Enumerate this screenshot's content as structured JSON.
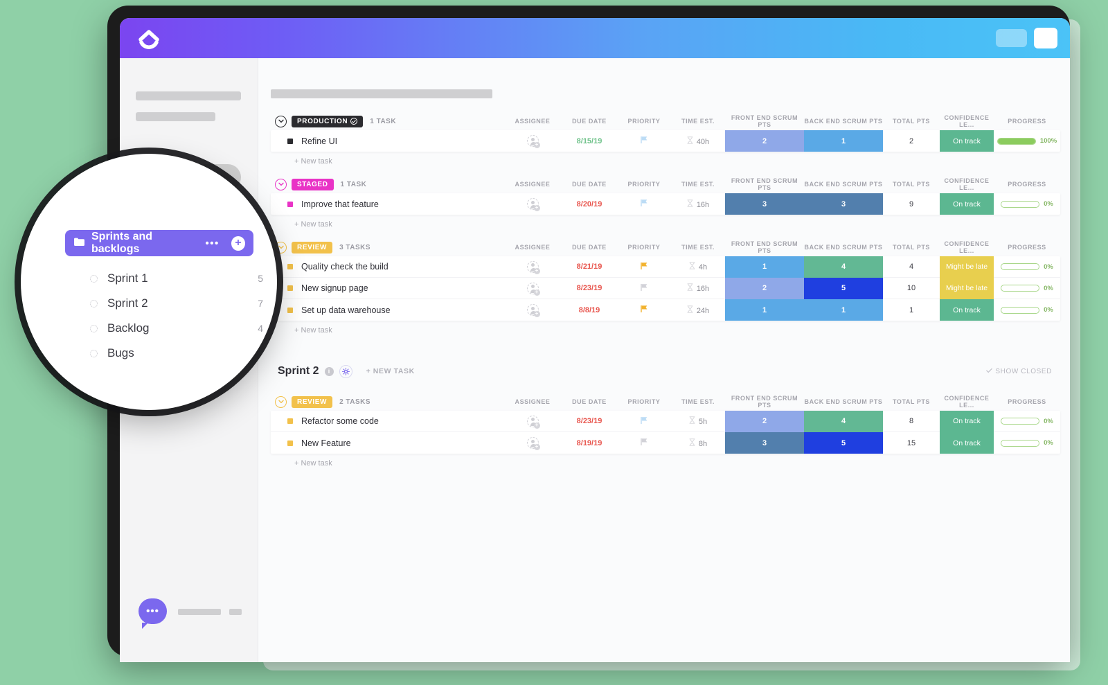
{
  "app": {
    "logo_icon": "clickup-logo-icon",
    "topbar_button_1": "",
    "topbar_button_2": ""
  },
  "sidebar": {
    "search_icon": "search-icon",
    "chat_icon": "chat-bubble-icon",
    "chat_label": "•••"
  },
  "magnifier": {
    "folder_icon": "folder-icon",
    "title": "Sprints and backlogs",
    "more_label": "•••",
    "add_label": "+",
    "items": [
      {
        "label": "Sprint 1",
        "count": "5"
      },
      {
        "label": "Sprint 2",
        "count": "7"
      },
      {
        "label": "Backlog",
        "count": "4"
      },
      {
        "label": "Bugs",
        "count": ""
      }
    ]
  },
  "columns": [
    "ASSIGNEE",
    "DUE DATE",
    "PRIORITY",
    "TIME EST.",
    "FRONT END SCRUM PTS",
    "BACK END SCRUM PTS",
    "TOTAL PTS",
    "CONFIDENCE LE...",
    "PROGRESS"
  ],
  "labels": {
    "new_task_inline": "+ New task",
    "new_task_button": "+ NEW TASK",
    "show_closed": "SHOW CLOSED",
    "check_icon": "check-icon"
  },
  "colors": {
    "production": "#2b2b2f",
    "staged": "#e933c6",
    "review": "#f2c14b",
    "fe_2": "#8fa8e8",
    "fe_1": "#5aa9e6",
    "fe_3": "#527fad",
    "be_1": "#5aa9e6",
    "be_3": "#527fad",
    "be_4": "#62b894",
    "be_5": "#1f3fe0",
    "on_track": "#5cb791",
    "might_be_late": "#e8cf4e",
    "date_ok": "#6fc28a",
    "date_late": "#e8554d",
    "progress": "#8ccc5e"
  },
  "sprint1": {
    "groups": [
      {
        "status": "PRODUCTION",
        "status_color": "#2b2b2f",
        "status_has_check": true,
        "count_label": "1 TASK",
        "tasks": [
          {
            "dot": "#2b2b2f",
            "name": "Refine UI",
            "due": "8/15/19",
            "due_state": "ok",
            "priority": "low",
            "time": "40h",
            "fe": "2",
            "fe_color": "#8fa8e8",
            "be": "1",
            "be_color": "#5aa9e6",
            "total": "2",
            "confidence": "On track",
            "confidence_color": "#5cb791",
            "progress": "100%",
            "progress_value": 100
          }
        ]
      },
      {
        "status": "STAGED",
        "status_color": "#e933c6",
        "status_has_check": false,
        "count_label": "1 TASK",
        "tasks": [
          {
            "dot": "#e933c6",
            "name": "Improve that feature",
            "due": "8/20/19",
            "due_state": "late",
            "priority": "low",
            "time": "16h",
            "fe": "3",
            "fe_color": "#527fad",
            "be": "3",
            "be_color": "#527fad",
            "total": "9",
            "confidence": "On track",
            "confidence_color": "#5cb791",
            "progress": "0%",
            "progress_value": 0
          }
        ]
      },
      {
        "status": "REVIEW",
        "status_color": "#f2c14b",
        "status_has_check": false,
        "count_label": "3 TASKS",
        "tasks": [
          {
            "dot": "#f2c14b",
            "name": "Quality check the build",
            "due": "8/21/19",
            "due_state": "late",
            "priority": "high",
            "time": "4h",
            "fe": "1",
            "fe_color": "#5aa9e6",
            "be": "4",
            "be_color": "#62b894",
            "total": "4",
            "confidence": "Might be late",
            "confidence_color": "#e8cf4e",
            "progress": "0%",
            "progress_value": 0
          },
          {
            "dot": "#f2c14b",
            "name": "New signup page",
            "due": "8/23/19",
            "due_state": "late",
            "priority": "none",
            "time": "16h",
            "fe": "2",
            "fe_color": "#8fa8e8",
            "be": "5",
            "be_color": "#1f3fe0",
            "total": "10",
            "confidence": "Might be late",
            "confidence_color": "#e8cf4e",
            "progress": "0%",
            "progress_value": 0
          },
          {
            "dot": "#f2c14b",
            "name": "Set up data warehouse",
            "due": "8/8/19",
            "due_state": "late",
            "priority": "high",
            "time": "24h",
            "fe": "1",
            "fe_color": "#5aa9e6",
            "be": "1",
            "be_color": "#5aa9e6",
            "total": "1",
            "confidence": "On track",
            "confidence_color": "#5cb791",
            "progress": "0%",
            "progress_value": 0
          }
        ]
      }
    ]
  },
  "sprint2": {
    "title": "Sprint 2",
    "info_icon": "info-icon",
    "settings_icon": "settings-icon",
    "groups": [
      {
        "status": "REVIEW",
        "status_color": "#f2c14b",
        "status_has_check": false,
        "count_label": "2 TASKS",
        "tasks": [
          {
            "dot": "#f2c14b",
            "name": "Refactor some code",
            "due": "8/23/19",
            "due_state": "late",
            "priority": "low",
            "time": "5h",
            "fe": "2",
            "fe_color": "#8fa8e8",
            "be": "4",
            "be_color": "#62b894",
            "total": "8",
            "confidence": "On track",
            "confidence_color": "#5cb791",
            "progress": "0%",
            "progress_value": 0
          },
          {
            "dot": "#f2c14b",
            "name": "New Feature",
            "due": "8/19/19",
            "due_state": "late",
            "priority": "none",
            "time": "8h",
            "fe": "3",
            "fe_color": "#527fad",
            "be": "5",
            "be_color": "#1f3fe0",
            "total": "15",
            "confidence": "On track",
            "confidence_color": "#5cb791",
            "progress": "0%",
            "progress_value": 0
          }
        ]
      }
    ]
  }
}
